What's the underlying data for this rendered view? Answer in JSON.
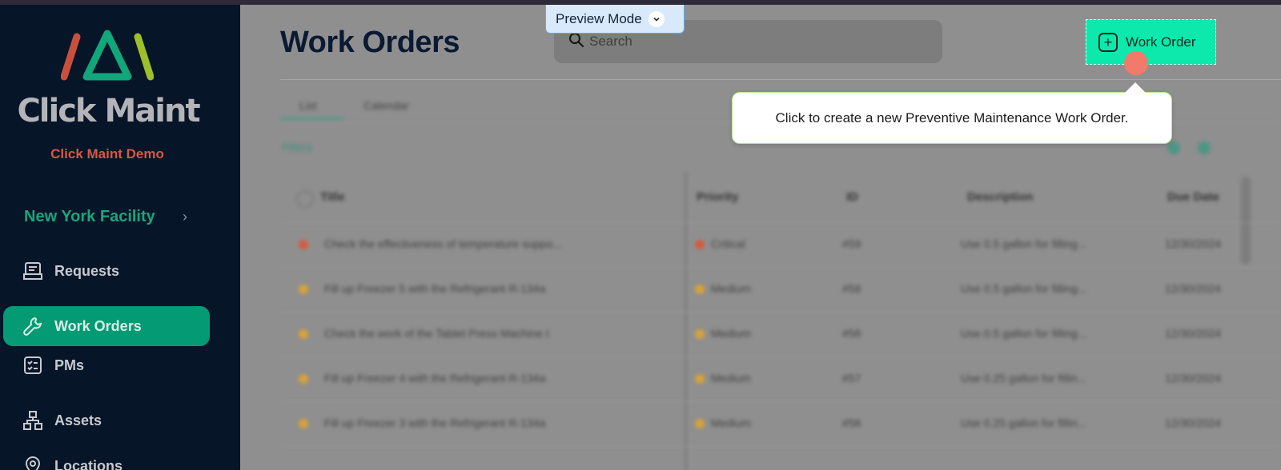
{
  "app": {
    "brand": "Click Maint",
    "org": "Click Maint Demo",
    "colors": {
      "accent": "#049a73",
      "sidebar": "#061528",
      "demo": "#d25a45"
    }
  },
  "preview_mode": {
    "label": "Preview Mode",
    "icon": "chevron-down-icon"
  },
  "sidebar": {
    "facility": "New York Facility",
    "items": [
      {
        "label": "Requests",
        "icon": "requests-icon",
        "active": false
      },
      {
        "label": "Work Orders",
        "icon": "wrench-icon",
        "active": true
      },
      {
        "label": "PMs",
        "icon": "checklist-icon",
        "active": false
      },
      {
        "label": "Assets",
        "icon": "hierarchy-icon",
        "active": false
      },
      {
        "label": "Locations",
        "icon": "location-pin-icon",
        "active": false
      }
    ]
  },
  "header": {
    "title": "Work Orders",
    "search_placeholder": "Search",
    "create_button": "Work Order"
  },
  "tooltip": {
    "text": "Click to create a new Preventive Maintenance Work Order."
  },
  "tabs": [
    "List",
    "Calendar"
  ],
  "filters_label": "Filters",
  "table": {
    "columns": [
      "Title",
      "Priority",
      "ID",
      "Description",
      "Due Date"
    ],
    "rows": [
      {
        "title": "Check the effectiveness of temperature suppo...",
        "priority": "Critical",
        "id": "#59",
        "description": "Use 0.5 gallon for filling...",
        "due": "12/30/2024",
        "color": "#d65a3e"
      },
      {
        "title": "Fill up Freezer 5 with the Refrigerant R-134a",
        "priority": "Medium",
        "id": "#58",
        "description": "Use 0.5 gallon for filling...",
        "due": "12/30/2024",
        "color": "#d8a23a"
      },
      {
        "title": "Check the work of the Tablet Press Machine I",
        "priority": "Medium",
        "id": "#56",
        "description": "Use 0.5 gallon for filling...",
        "due": "12/30/2024",
        "color": "#d8a23a"
      },
      {
        "title": "Fill up Freezer 4 with the Refrigerant R-134a",
        "priority": "Medium",
        "id": "#57",
        "description": "Use 0.25 gallon for fillin...",
        "due": "12/30/2024",
        "color": "#d8a23a"
      },
      {
        "title": "Fill up Freezer 3 with the Refrigerant R-134a",
        "priority": "Medium",
        "id": "#56",
        "description": "Use 0.25 gallon for fillin...",
        "due": "12/30/2024",
        "color": "#d8a23a"
      }
    ]
  }
}
